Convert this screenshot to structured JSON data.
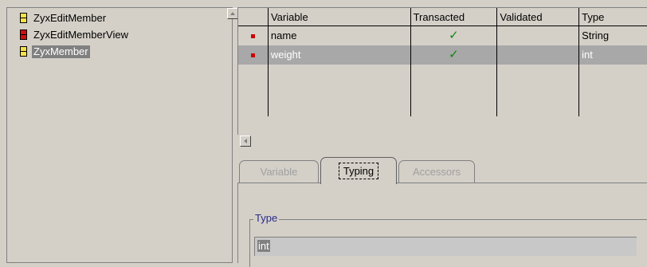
{
  "class_list": {
    "items": [
      {
        "label": "ZyxEditMember",
        "icon": "class-yellow-icon",
        "color": "#f5e14a",
        "selected": false
      },
      {
        "label": "ZyxEditMemberView",
        "icon": "class-red-icon",
        "color": "#cc1111",
        "selected": false
      },
      {
        "label": "ZyxMember",
        "icon": "class-yellow-icon",
        "color": "#f5e14a",
        "selected": true
      }
    ]
  },
  "variables_table": {
    "columns": [
      "Variable",
      "Transacted",
      "Validated",
      "Type"
    ],
    "rows": [
      {
        "variable": "name",
        "transacted": "✓",
        "validated": "",
        "type": "String",
        "selected": false
      },
      {
        "variable": "weight",
        "transacted": "✓",
        "validated": "",
        "type": "int",
        "selected": true
      }
    ]
  },
  "tabs": [
    {
      "label": "Variable",
      "active": false
    },
    {
      "label": "Typing",
      "active": true
    },
    {
      "label": "Accessors",
      "active": false
    }
  ],
  "typing_panel": {
    "group_title": "Type",
    "type_value": "int"
  },
  "colors": {
    "background": "#d4d0c8",
    "selection": "#808080",
    "row_marker": "#cc0000",
    "check": "#0a8a0a",
    "group_title": "#2a2a8a"
  }
}
